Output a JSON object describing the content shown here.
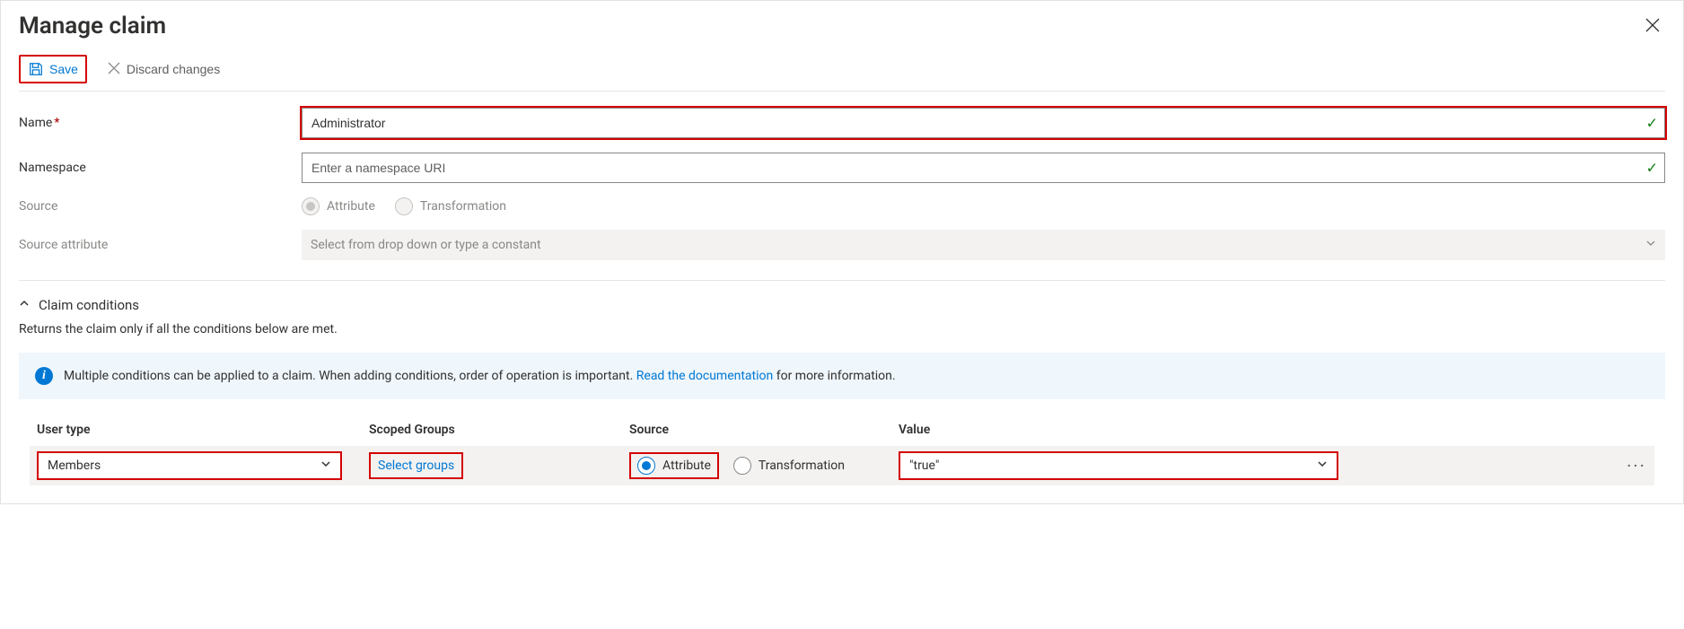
{
  "title": "Manage claim",
  "toolbar": {
    "save_label": "Save",
    "discard_label": "Discard changes"
  },
  "form": {
    "name_label": "Name",
    "name_value": "Administrator",
    "namespace_label": "Namespace",
    "namespace_placeholder": "Enter a namespace URI",
    "source_label": "Source",
    "source_attribute": "Attribute",
    "source_transformation": "Transformation",
    "source_attr_label": "Source attribute",
    "source_attr_placeholder": "Select from drop down or type a constant"
  },
  "conditions": {
    "section_title": "Claim conditions",
    "description": "Returns the claim only if all the conditions below are met.",
    "info_prefix": "Multiple conditions can be applied to a claim.  When adding conditions, order of operation is important. ",
    "info_link": "Read the documentation",
    "info_suffix": " for more information.",
    "headers": {
      "user_type": "User type",
      "scoped_groups": "Scoped Groups",
      "source": "Source",
      "value": "Value"
    },
    "row": {
      "user_type": "Members",
      "scoped_groups": "Select groups",
      "source_attribute": "Attribute",
      "source_transformation": "Transformation",
      "value": "\"true\""
    }
  }
}
